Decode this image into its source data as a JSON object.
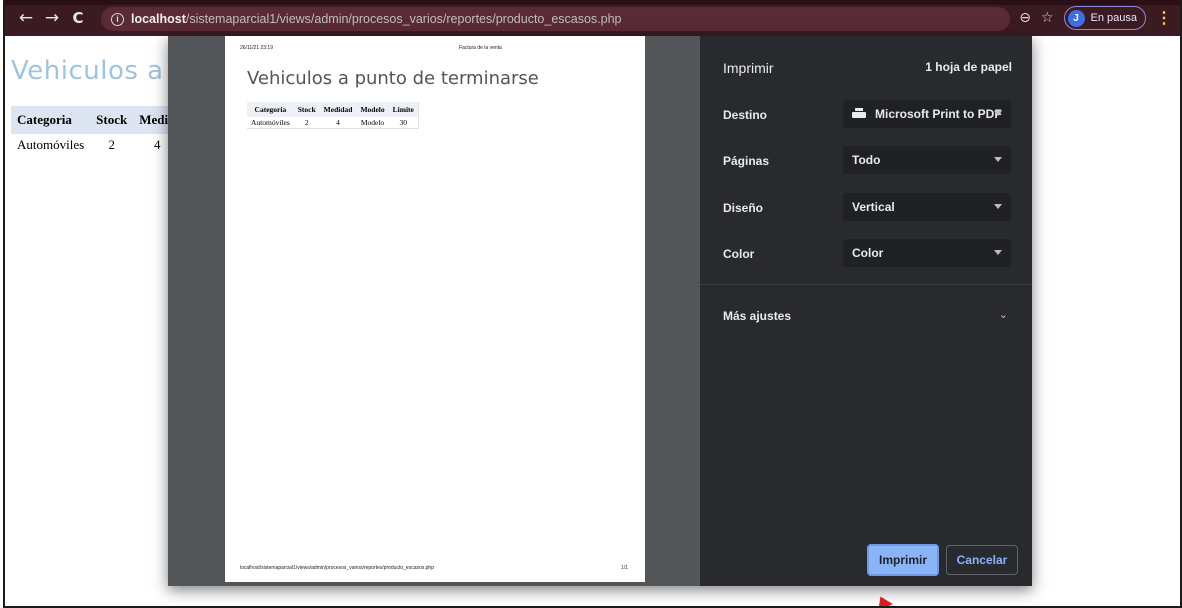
{
  "browser": {
    "back_icon": "←",
    "forward_icon": "→",
    "reload_icon": "C",
    "url_host": "localhost",
    "url_path": "/sistemaparcial1/views/admin/procesos_varios/reportes/producto_escasos.php",
    "zoom_icon": "⊖",
    "star_icon": "☆",
    "profile_initial": "J",
    "profile_status": "En pausa",
    "menu_icon": "⋮"
  },
  "page": {
    "title": "Vehiculos a p",
    "table": {
      "headers": [
        "Categoria",
        "Stock",
        "Medid"
      ],
      "row": [
        "Automóviles",
        "2",
        "4"
      ]
    }
  },
  "preview": {
    "header_date": "26/11/21 23:19",
    "header_title": "Factura de la venta",
    "document_title": "Vehiculos a punto de terminarse",
    "table": {
      "headers": [
        "Categoria",
        "Stock",
        "Medidad",
        "Modelo",
        "Limite"
      ],
      "row": [
        "Automóviles",
        "2",
        "4",
        "Modelo",
        "30"
      ]
    },
    "footer_url": "localhost/sistemaparcial1/views/admin/procesos_varios/reportes/producto_escasos.php",
    "footer_page": "1/1"
  },
  "print_settings": {
    "title": "Imprimir",
    "sheets": "1 hoja de papel",
    "destination_label": "Destino",
    "destination_value": "Microsoft Print to PDF",
    "pages_label": "Páginas",
    "pages_value": "Todo",
    "layout_label": "Diseño",
    "layout_value": "Vertical",
    "color_label": "Color",
    "color_value": "Color",
    "more_settings": "Más ajustes",
    "print_button": "Imprimir",
    "cancel_button": "Cancelar"
  },
  "colors": {
    "toolbar": "#3c1a22",
    "panel": "#292a2d",
    "accent": "#8ab4f8",
    "page_title": "#9ec4e2"
  }
}
